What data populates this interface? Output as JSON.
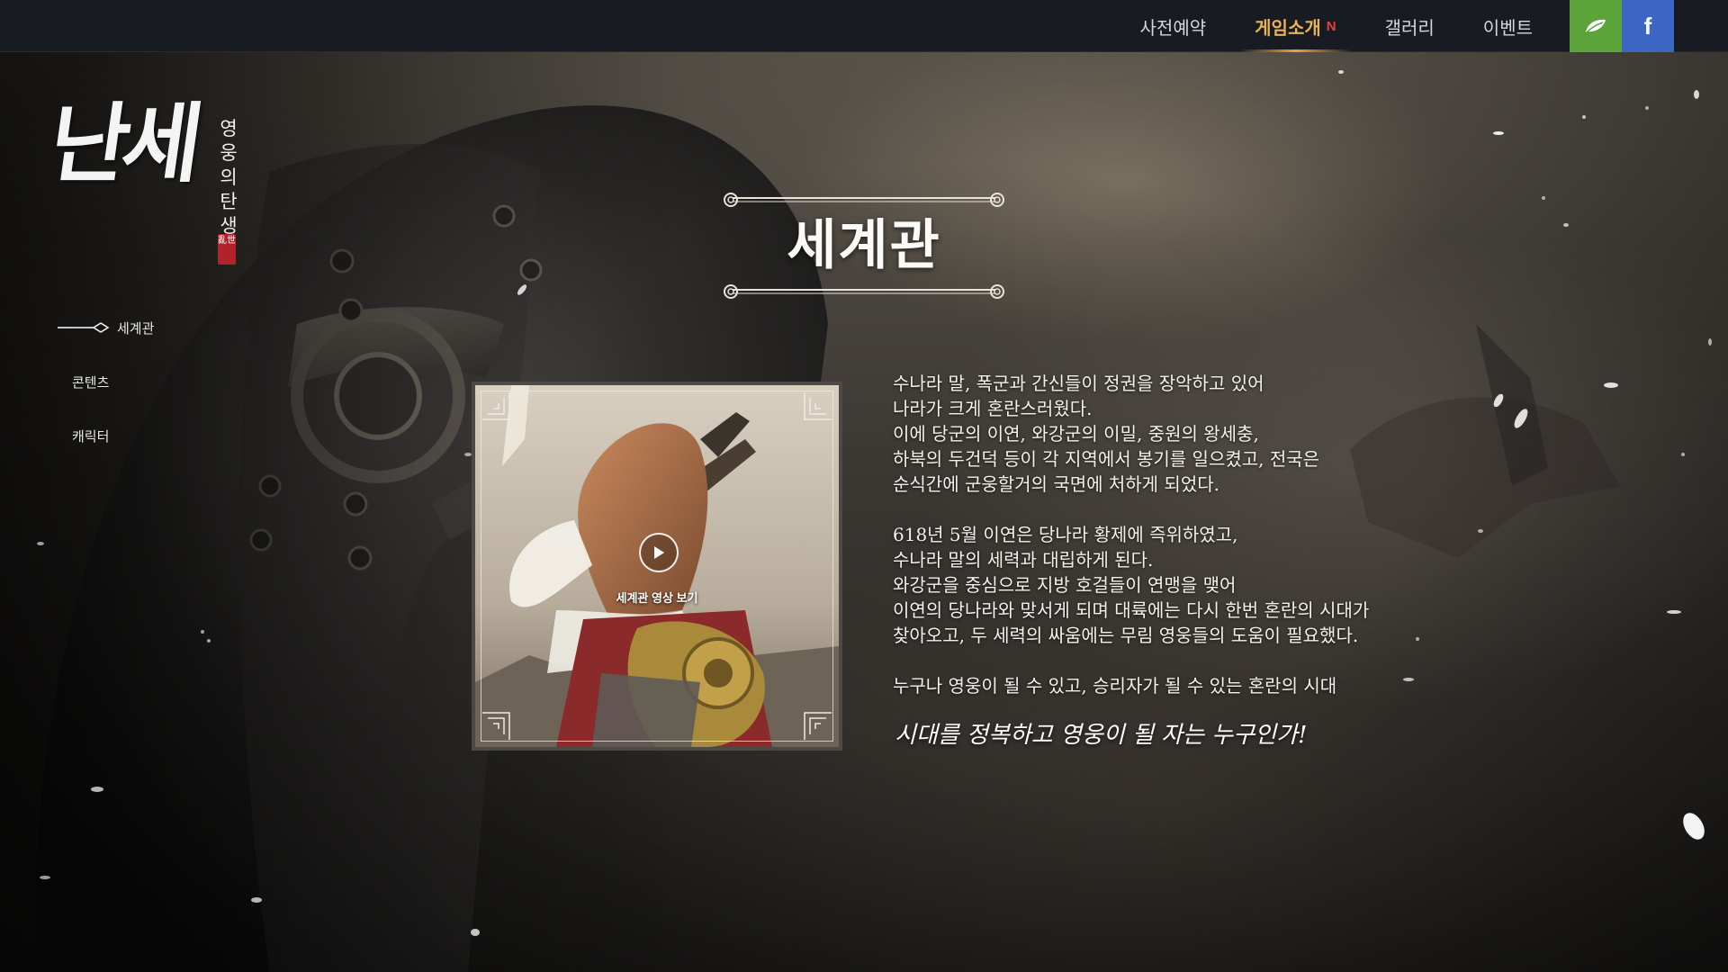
{
  "nav": {
    "items": [
      {
        "label": "사전예약",
        "active": false
      },
      {
        "label": "게임소개",
        "active": true,
        "badge": "N"
      },
      {
        "label": "갤러리",
        "active": false
      },
      {
        "label": "이벤트",
        "active": false
      }
    ],
    "social": [
      {
        "name": "leaf-icon",
        "color": "#5aa43a"
      },
      {
        "name": "facebook-icon",
        "label": "f",
        "color": "#3c66c4"
      }
    ]
  },
  "logo": {
    "main": "난세",
    "subtitle": "영웅의탄생",
    "seal": "亂世"
  },
  "sidebar": {
    "items": [
      {
        "label": "세계관",
        "active": true
      },
      {
        "label": "콘텐츠",
        "active": false
      },
      {
        "label": "캐릭터",
        "active": false
      }
    ]
  },
  "main": {
    "title": "세계관",
    "video_label": "세계관 영상 보기",
    "paragraphs": [
      {
        "lines": [
          "수나라 말, 폭군과 간신들이 정권을 장악하고 있어",
          "나라가 크게 혼란스러웠다.",
          "이에 당군의 이연, 와강군의 이밀, 중원의 왕세충,",
          "하북의 두건덕 등이 각 지역에서 봉기를 일으켰고, 전국은",
          "순식간에 군웅할거의 국면에 처하게 되었다."
        ]
      },
      {
        "lines": [
          "618년 5월 이연은 당나라 황제에 즉위하였고,",
          "수나라 말의 세력과 대립하게 된다.",
          "와강군을 중심으로 지방 호걸들이 연맹을 맺어",
          "이연의 당나라와 맞서게 되며 대륙에는 다시 한번 혼란의 시대가",
          "찾아오고, 두 세력의 싸움에는 무림 영웅들의 도움이 필요했다."
        ]
      },
      {
        "lines": [
          "누구나 영웅이 될 수 있고, 승리자가 될 수 있는 혼란의 시대"
        ]
      }
    ],
    "tagline": "시대를 정복하고 영웅이 될 자는 누구인가!"
  },
  "colors": {
    "accent": "#e6b35a",
    "badge": "#e0443a",
    "topbar": "#181b22"
  }
}
